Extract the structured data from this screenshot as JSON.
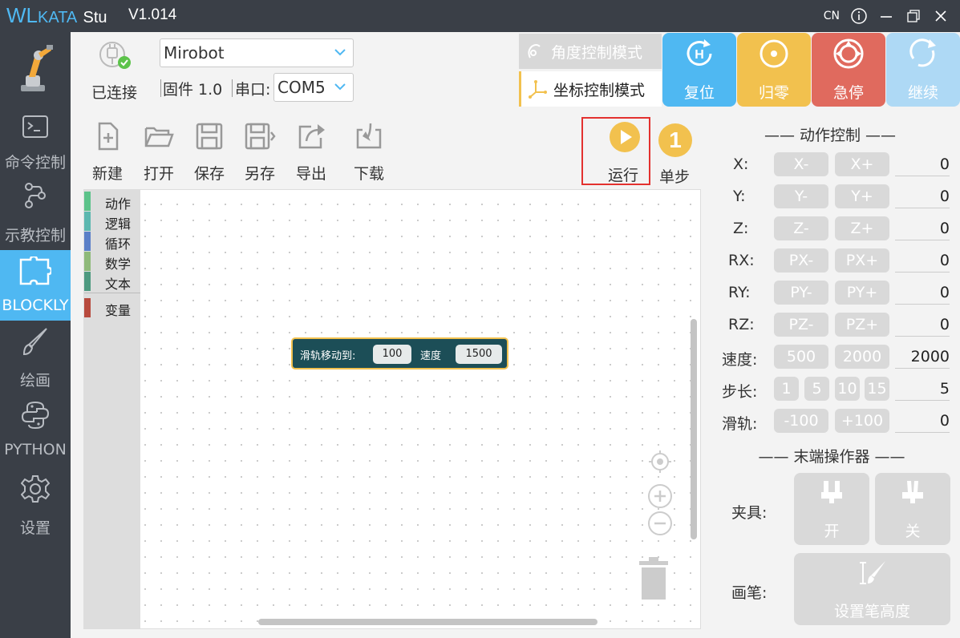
{
  "titlebar": {
    "logo_wl": "WL",
    "logo_kata": "KATA",
    "logo_stu": "Stu",
    "version": "V1.014",
    "lang": "CN"
  },
  "sidebar": {
    "items": [
      {
        "label": "",
        "icon": "robot-arm-logo"
      },
      {
        "label": "命令控制",
        "icon": "terminal-icon"
      },
      {
        "label": "示教控制",
        "icon": "teach-path-icon"
      },
      {
        "label": "BLOCKLY",
        "icon": "puzzle-icon"
      },
      {
        "label": "绘画",
        "icon": "brush-icon"
      },
      {
        "label": "PYTHON",
        "icon": "python-icon"
      },
      {
        "label": "设置",
        "icon": "gear-icon"
      }
    ]
  },
  "connection": {
    "status": "已连接",
    "device": "Mirobot",
    "firmware": "固件 1.0",
    "port_label": "串口:",
    "port": "COM5"
  },
  "modes": {
    "angle": "角度控制模式",
    "coord": "坐标控制模式"
  },
  "actions": {
    "reset": "复位",
    "home": "归零",
    "estop": "急停",
    "resume": "继续"
  },
  "toolbar": {
    "new": "新建",
    "open": "打开",
    "save": "保存",
    "save_as": "另存",
    "export": "导出",
    "download": "下载",
    "run": "运行",
    "step": "单步",
    "step_num": "1"
  },
  "toolbox": {
    "categories": [
      "动作",
      "逻辑",
      "循环",
      "数学",
      "文本",
      "变量"
    ]
  },
  "block": {
    "label1": "滑轨移动到:",
    "value1": "100",
    "label2": "速度",
    "value2": "1500"
  },
  "panel": {
    "motion_title": "—— 动作控制 ——",
    "rows": [
      {
        "label": "X:",
        "minus": "X-",
        "plus": "X+",
        "value": "0"
      },
      {
        "label": "Y:",
        "minus": "Y-",
        "plus": "Y+",
        "value": "0"
      },
      {
        "label": "Z:",
        "minus": "Z-",
        "plus": "Z+",
        "value": "0"
      },
      {
        "label": "RX:",
        "minus": "PX-",
        "plus": "PX+",
        "value": "0"
      },
      {
        "label": "RY:",
        "minus": "PY-",
        "plus": "PY+",
        "value": "0"
      },
      {
        "label": "RZ:",
        "minus": "PZ-",
        "plus": "PZ+",
        "value": "0"
      }
    ],
    "speed": {
      "label": "速度:",
      "a": "500",
      "b": "2000",
      "value": "2000"
    },
    "step": {
      "label": "步长:",
      "opts": [
        "1",
        "5",
        "10",
        "15"
      ],
      "value": "5"
    },
    "rail": {
      "label": "滑轨:",
      "minus": "-100",
      "plus": "+100",
      "value": "0"
    },
    "effector_title": "—— 末端操作器 ——",
    "gripper": {
      "label": "夹具:",
      "open": "开",
      "close": "关"
    },
    "pen": {
      "label": "画笔:",
      "set": "设置笔高度"
    }
  },
  "colors": {
    "sidebar_bg": "#3a3f47",
    "accent_blue": "#4fb8f2",
    "yellow": "#f2c14e",
    "red": "#e06a5e",
    "light_blue": "#aed9f5"
  }
}
